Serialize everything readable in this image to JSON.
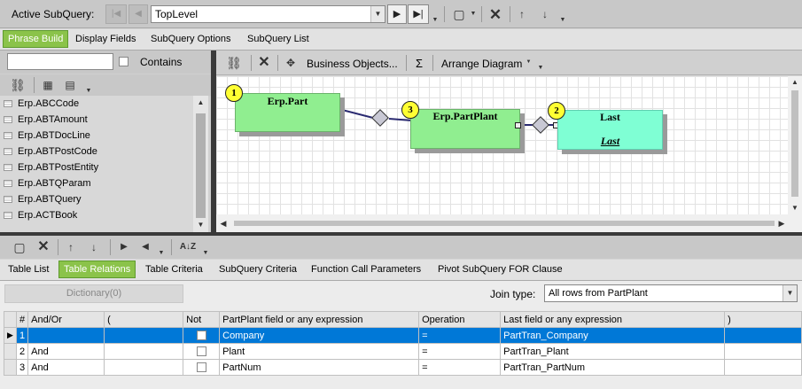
{
  "top": {
    "label": "Active SubQuery:",
    "combo_value": "TopLevel"
  },
  "tabs": [
    {
      "label": "Phrase Build",
      "active": true
    },
    {
      "label": "Display Fields"
    },
    {
      "label": "SubQuery Options"
    },
    {
      "label": "SubQuery List"
    }
  ],
  "left": {
    "search_value": "",
    "contains_label": "Contains",
    "items": [
      "Erp.ABCCode",
      "Erp.ABTAmount",
      "Erp.ABTDocLine",
      "Erp.ABTPostCode",
      "Erp.ABTPostEntity",
      "Erp.ABTQParam",
      "Erp.ABTQuery",
      "Erp.ACTBook"
    ]
  },
  "diagram_toolbar": {
    "business_objects": "Business Objects...",
    "sigma": "Σ",
    "arrange": "Arrange Diagram"
  },
  "diagram": {
    "nodes": [
      {
        "badge": "1",
        "title": "Erp.Part",
        "subtitle": ""
      },
      {
        "badge": "3",
        "title": "Erp.PartPlant",
        "subtitle": ""
      },
      {
        "badge": "2",
        "title": "Last",
        "subtitle": "Last"
      }
    ]
  },
  "bottom_tabs": [
    {
      "label": "Table List"
    },
    {
      "label": "Table Relations",
      "active": true
    },
    {
      "label": "Table Criteria"
    },
    {
      "label": "SubQuery Criteria"
    },
    {
      "label": "Function Call Parameters"
    },
    {
      "label": "Pivot SubQuery FOR Clause"
    }
  ],
  "relations": {
    "dictionary_button": "Dictionary(0)",
    "join_label": "Join type:",
    "join_value": "All rows from PartPlant",
    "columns": [
      "#",
      "And/Or",
      "(",
      "Not",
      "PartPlant field or any expression",
      "Operation",
      "Last field or any expression",
      ")"
    ],
    "rows": [
      {
        "num": "1",
        "andor": "",
        "open": "",
        "field": "Company",
        "op": "=",
        "last": "PartTran_Company",
        "close": "",
        "selected": true
      },
      {
        "num": "2",
        "andor": "And",
        "open": "",
        "field": "Plant",
        "op": "=",
        "last": "PartTran_Plant",
        "close": ""
      },
      {
        "num": "3",
        "andor": "And",
        "open": "",
        "field": "PartNum",
        "op": "=",
        "last": "PartTran_PartNum",
        "close": ""
      }
    ]
  },
  "colors": {
    "accent_green": "#8bc34a",
    "selection_blue": "#0078d7",
    "node_green": "#90ee90",
    "node_cyan": "#7fffd4"
  }
}
